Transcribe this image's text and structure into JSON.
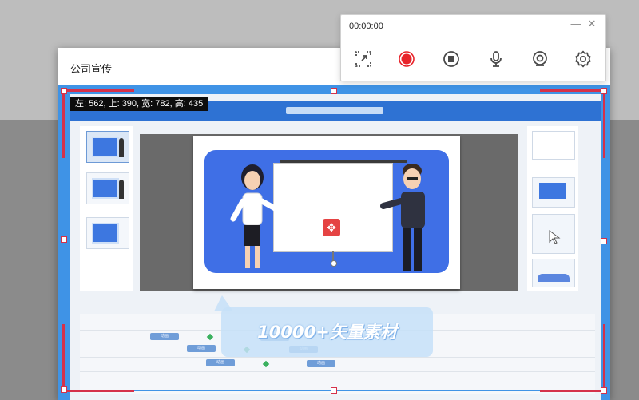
{
  "editor": {
    "title": "公司宣传"
  },
  "recorder": {
    "time": "00:00:00",
    "minimize_label": "—",
    "close_label": "✕",
    "buttons": [
      {
        "name": "region-select-icon",
        "tooltip": ""
      },
      {
        "name": "record-icon",
        "color": "#e8242b"
      },
      {
        "name": "stop-icon"
      },
      {
        "name": "microphone-icon"
      },
      {
        "name": "webcam-icon"
      },
      {
        "name": "gear-icon"
      }
    ]
  },
  "region": {
    "readout": "左: 562, 上: 390, 宽: 782, 高: 435",
    "accent_color": "#d5314a",
    "outline_color": "#3f93e6"
  },
  "stage": {
    "move_icon": "move-icon"
  },
  "timeline": {
    "chips": [
      "动画",
      "动画",
      "动画",
      "动画",
      "动画",
      "动画"
    ]
  },
  "watermark": {
    "text": "10000+矢量素材"
  },
  "colors": {
    "brand_blue": "#2e72d3",
    "slide_blue": "#3f6fe6",
    "record_red": "#e8242b"
  }
}
